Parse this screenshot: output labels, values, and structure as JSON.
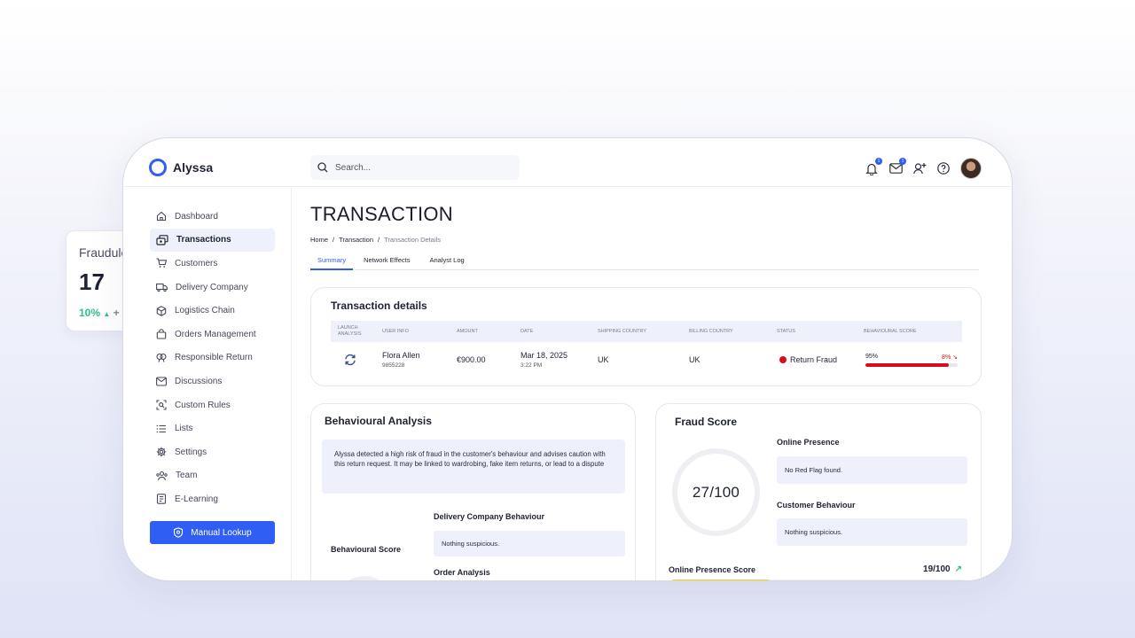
{
  "background_card": {
    "title": "Fraudule",
    "number": "17",
    "percent": "10%",
    "trend": "+"
  },
  "app": {
    "name": "Alyssa"
  },
  "search": {
    "placeholder": "Search..."
  },
  "topbar": {
    "notifications_badge": "1",
    "messages_badge": "1"
  },
  "sidebar": {
    "items": [
      {
        "label": "Dashboard",
        "icon": "home-icon"
      },
      {
        "label": "Transactions",
        "icon": "transactions-icon",
        "active": true
      },
      {
        "label": "Customers",
        "icon": "cart-icon"
      },
      {
        "label": "Delivery Company",
        "icon": "truck-icon"
      },
      {
        "label": "Logistics Chain",
        "icon": "box-icon"
      },
      {
        "label": "Orders Management",
        "icon": "bag-icon"
      },
      {
        "label": "Responsible Return",
        "icon": "return-icon"
      },
      {
        "label": "Discussions",
        "icon": "mail-icon"
      },
      {
        "label": "Custom Rules",
        "icon": "rules-icon"
      },
      {
        "label": "Lists",
        "icon": "list-icon"
      },
      {
        "label": "Settings",
        "icon": "gear-icon"
      },
      {
        "label": "Team",
        "icon": "team-icon"
      },
      {
        "label": "E-Learning",
        "icon": "elearning-icon"
      }
    ],
    "lookup_label": "Manual Lookup"
  },
  "page": {
    "title": "TRANSACTION",
    "breadcrumb": [
      "Home",
      "/",
      "Transaction",
      "/",
      "Transaction Details"
    ],
    "tabs": [
      "Summary",
      "Network Effects",
      "Analyst Log"
    ]
  },
  "transaction_details": {
    "title": "Transaction details",
    "columns": [
      "LAUNCH ANALYSIS",
      "USER INFO",
      "AMOUNT",
      "DATE",
      "SHIPPING COUNTRY",
      "BILLING COUNTRY",
      "STATUS",
      "BEHAVIOURAL SCORE"
    ],
    "row": {
      "user_name": "Flora Allen",
      "user_id": "9855228",
      "amount": "€900.00",
      "date": "Mar 18, 2025",
      "time": "3:22 PM",
      "shipping_country": "UK",
      "billing_country": "UK",
      "status": "Return Fraud",
      "status_color": "#d90c1f",
      "score_left": "95%",
      "score_right": "8%",
      "score_fill": 0.9
    }
  },
  "behavioural_analysis": {
    "title": "Behavioural Analysis",
    "alert": "Alyssa detected a high risk of fraud in the customer's behaviour and advises caution with this return request. It may be linked to wardrobing, fake item returns, or lead to a dispute",
    "score_label": "Behavioural Score",
    "delivery_title": "Delivery Company Behaviour",
    "delivery_value": "Nothing suspicious.",
    "order_title": "Order Analysis"
  },
  "fraud_score": {
    "title": "Fraud Score",
    "score": "27/100",
    "online_presence_title": "Online Presence",
    "online_presence_value": "No Red Flag found.",
    "customer_behaviour_title": "Customer Behaviour",
    "customer_behaviour_value": "Nothing suspicious.",
    "ops_label": "Online Presence Score",
    "ops_value": "19/100",
    "ops_fill": 0.34,
    "ops_color": "#f5cf1c"
  },
  "colors": {
    "accent": "#2f5ef5",
    "danger": "#d90c1f",
    "success": "#2bc48a"
  }
}
